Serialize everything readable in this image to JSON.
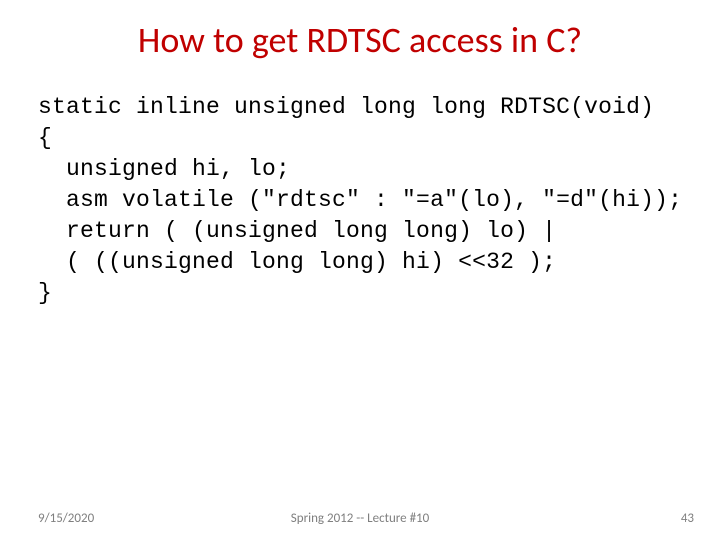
{
  "title": "How to get RDTSC access in C?",
  "code": {
    "l1": "static inline unsigned long long RDTSC(void)",
    "l2": "{",
    "l3": "  unsigned hi, lo;",
    "l4": "  asm volatile (\"rdtsc\" : \"=a\"(lo), \"=d\"(hi));",
    "l5": "  return ( (unsigned long long) lo) |",
    "l6": "  ( ((unsigned long long) hi) <<32 );",
    "l7": "}"
  },
  "footer": {
    "date": "9/15/2020",
    "center": "Spring 2012 -- Lecture #10",
    "pagenum": "43"
  }
}
